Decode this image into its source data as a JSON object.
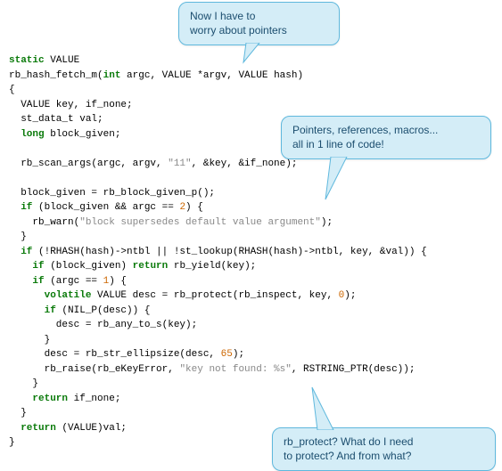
{
  "callouts": {
    "c1": {
      "line1": "Now I have to",
      "line2": "worry about pointers"
    },
    "c2": {
      "line1": "Pointers, references, macros...",
      "line2": "all in 1 line of code!"
    },
    "c3": {
      "line1": "rb_protect? What do I need",
      "line2": "to protect? And from what?"
    }
  },
  "code": {
    "l01a": "static",
    "l01b": " VALUE",
    "l02a": "rb_hash_fetch_m(",
    "l02b": "int",
    "l02c": " argc, VALUE *argv, VALUE hash)",
    "l03": "{",
    "l04": "  VALUE key, if_none;",
    "l05": "  st_data_t val;",
    "l06a": "  ",
    "l06b": "long",
    "l06c": " block_given;",
    "l07": "",
    "l08a": "  rb_scan_args(argc, argv, ",
    "l08b": "\"11\"",
    "l08c": ", &key, &if_none);",
    "l09": "",
    "l10": "  block_given = rb_block_given_p();",
    "l11a": "  ",
    "l11b": "if",
    "l11c": " (block_given && argc == ",
    "l11d": "2",
    "l11e": ") {",
    "l12a": "    rb_warn(",
    "l12b": "\"block supersedes default value argument\"",
    "l12c": ");",
    "l13": "  }",
    "l14a": "  ",
    "l14b": "if",
    "l14c": " (!RHASH(hash)->ntbl || !st_lookup(RHASH(hash)->ntbl, key, &val)) {",
    "l15a": "    ",
    "l15b": "if",
    "l15c": " (block_given) ",
    "l15d": "return",
    "l15e": " rb_yield(key);",
    "l16a": "    ",
    "l16b": "if",
    "l16c": " (argc == ",
    "l16d": "1",
    "l16e": ") {",
    "l17a": "      ",
    "l17b": "volatile",
    "l17c": " VALUE desc = rb_protect(rb_inspect, key, ",
    "l17d": "0",
    "l17e": ");",
    "l18a": "      ",
    "l18b": "if",
    "l18c": " (NIL_P(desc)) {",
    "l19": "        desc = rb_any_to_s(key);",
    "l20": "      }",
    "l21a": "      desc = rb_str_ellipsize(desc, ",
    "l21b": "65",
    "l21c": ");",
    "l22a": "      rb_raise(rb_eKeyError, ",
    "l22b": "\"key not found: %s\"",
    "l22c": ", RSTRING_PTR(desc));",
    "l23": "    }",
    "l24a": "    ",
    "l24b": "return",
    "l24c": " if_none;",
    "l25": "  }",
    "l26a": "  ",
    "l26b": "return",
    "l26c": " (VALUE)val;",
    "l27": "}"
  }
}
